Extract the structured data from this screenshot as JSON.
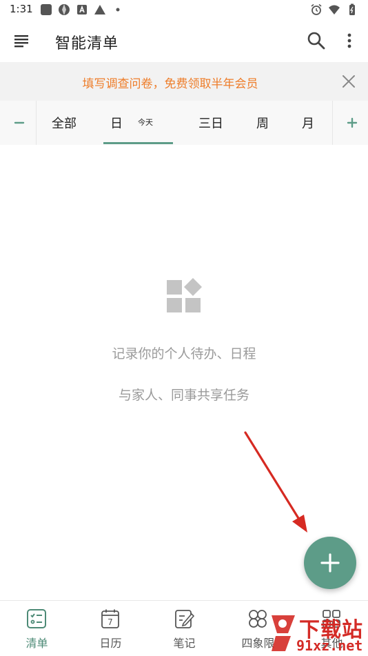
{
  "status_bar": {
    "time": "1:31"
  },
  "app_bar": {
    "title": "智能清单"
  },
  "banner": {
    "text": "填写调查问卷，免费领取半年会员"
  },
  "tabs": {
    "minus": "−",
    "plus": "+",
    "items": [
      {
        "label": "全部"
      },
      {
        "label": "日",
        "sub": "今天"
      },
      {
        "label": "三日"
      },
      {
        "label": "周"
      },
      {
        "label": "月"
      }
    ],
    "selected": "日"
  },
  "empty_state": {
    "line1": "记录你的个人待办、日程",
    "line2": "与家人、同事共享任务"
  },
  "bottom_nav": {
    "items": [
      {
        "label": "清单",
        "icon": "checklist-icon",
        "active": true
      },
      {
        "label": "日历",
        "icon": "calendar-icon",
        "calendar_day": "7"
      },
      {
        "label": "笔记",
        "icon": "note-icon"
      },
      {
        "label": "四象限",
        "icon": "quadrant-icon"
      },
      {
        "label": "其他",
        "icon": "other-icon"
      }
    ]
  },
  "watermark": {
    "brand": "下载站",
    "url": "91xz.net"
  },
  "colors": {
    "accent": "#5d9c88",
    "banner_text": "#ee7d2a",
    "annotation_arrow": "#d62a22"
  }
}
